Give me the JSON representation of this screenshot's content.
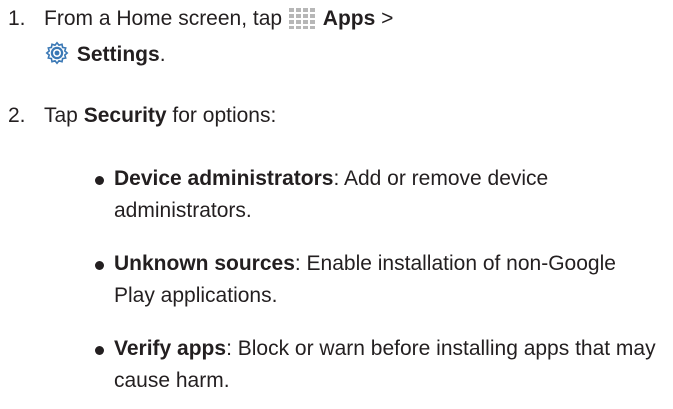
{
  "steps": [
    {
      "number": "1.",
      "parts": {
        "lead": "From a Home screen, tap",
        "apps_label": "Apps",
        "sep": ">",
        "settings_label": "Settings",
        "end": "."
      },
      "icons": [
        "apps-grid-icon",
        "settings-gear-icon"
      ]
    },
    {
      "number": "2.",
      "parts": {
        "lead": "Tap",
        "security_label": "Security",
        "tail": "for options:"
      }
    }
  ],
  "options": [
    {
      "term": "Device administrators",
      "desc": ": Add or remove device administrators."
    },
    {
      "term": "Unknown sources",
      "desc": ": Enable installation of non-Google Play applications."
    },
    {
      "term": "Verify apps",
      "desc": ": Block or warn before installing apps that may cause harm."
    }
  ],
  "colors": {
    "text": "#231f20",
    "apps_icon": "#b7b7b7",
    "settings_icon_blue": "#3a78b5"
  }
}
